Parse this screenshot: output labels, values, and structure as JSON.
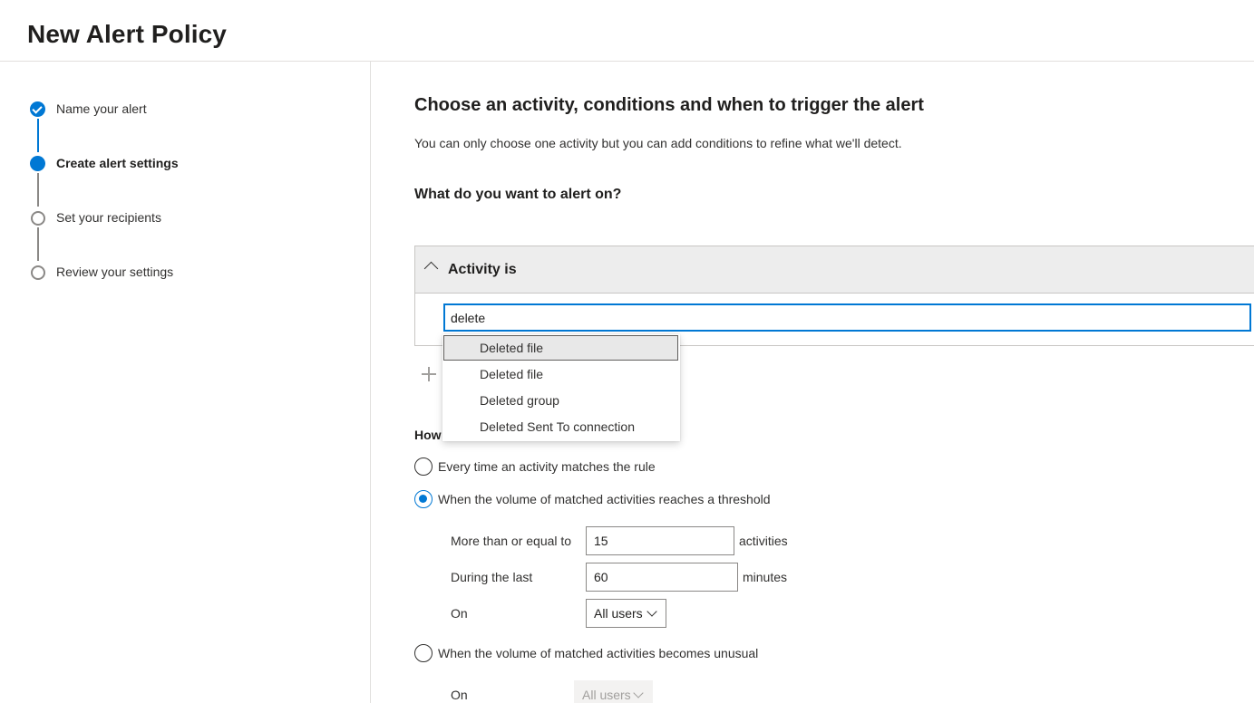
{
  "page": {
    "title": "New Alert Policy"
  },
  "wizard": {
    "steps": [
      {
        "label": "Name your alert",
        "state": "done"
      },
      {
        "label": "Create alert settings",
        "state": "current"
      },
      {
        "label": "Set your recipients",
        "state": "todo"
      },
      {
        "label": "Review your settings",
        "state": "todo"
      }
    ]
  },
  "main": {
    "title": "Choose an activity, conditions and when to trigger the alert",
    "description": "You can only choose one activity but you can add conditions to refine what we'll detect.",
    "alert_on_label": "What do you want to alert on?",
    "activity": {
      "header": "Activity is",
      "search_value": "delete",
      "suggestions": [
        "Deleted file",
        "Deleted file",
        "Deleted group",
        "Deleted Sent To connection"
      ],
      "highlighted_index": 0
    },
    "trigger": {
      "heading_visible": "How",
      "options": [
        {
          "label": "Every time an activity matches the rule",
          "checked": false
        },
        {
          "label": "When the volume of matched activities reaches a threshold",
          "checked": true
        },
        {
          "label": "When the volume of matched activities becomes unusual",
          "checked": false
        }
      ],
      "threshold": {
        "count_label": "More than or equal to",
        "count_value": "15",
        "count_unit": "activities",
        "window_label": "During the last",
        "window_value": "60",
        "window_unit": "minutes",
        "scope_label": "On",
        "scope_value": "All users"
      },
      "unusual": {
        "scope_label": "On",
        "scope_value": "All users"
      }
    }
  },
  "colors": {
    "accent": "#0078d4",
    "border": "#8a8886",
    "header_bg": "#ededed"
  },
  "icons": {
    "done_step": "check-circle-icon",
    "add": "plus-icon",
    "expand": "chevron-up-icon",
    "dropdown": "chevron-down-icon"
  }
}
